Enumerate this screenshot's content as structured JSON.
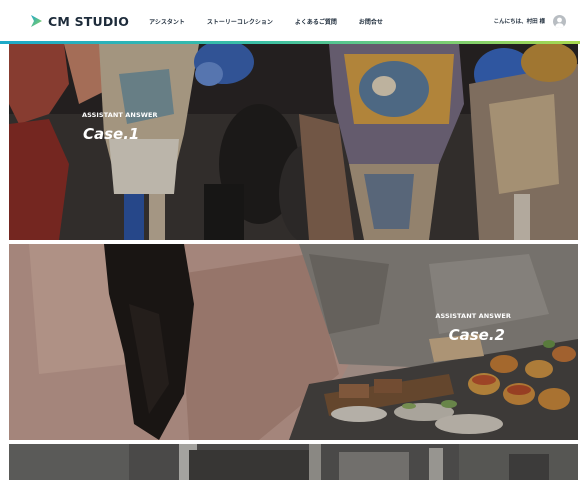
{
  "header": {
    "brand": "CM STUDIO",
    "nav": [
      {
        "label": "アシスタント"
      },
      {
        "label": "ストーリーコレクション"
      },
      {
        "label": "よくあるご質問"
      },
      {
        "label": "お問合せ"
      }
    ],
    "greeting": "こんにちは、村田 様",
    "icons": [
      "play-logo-icon",
      "user-avatar-icon"
    ],
    "colors": {
      "accent_start": "#1ea9c8",
      "accent_end": "#a8d84e",
      "text": "#1d2b3a"
    }
  },
  "cases": [
    {
      "kicker": "ASSISTANT ANSWER",
      "title": "Case.1"
    },
    {
      "kicker": "ASSISTANT ANSWER",
      "title": "Case.2"
    },
    {
      "kicker": "",
      "title": ""
    }
  ]
}
